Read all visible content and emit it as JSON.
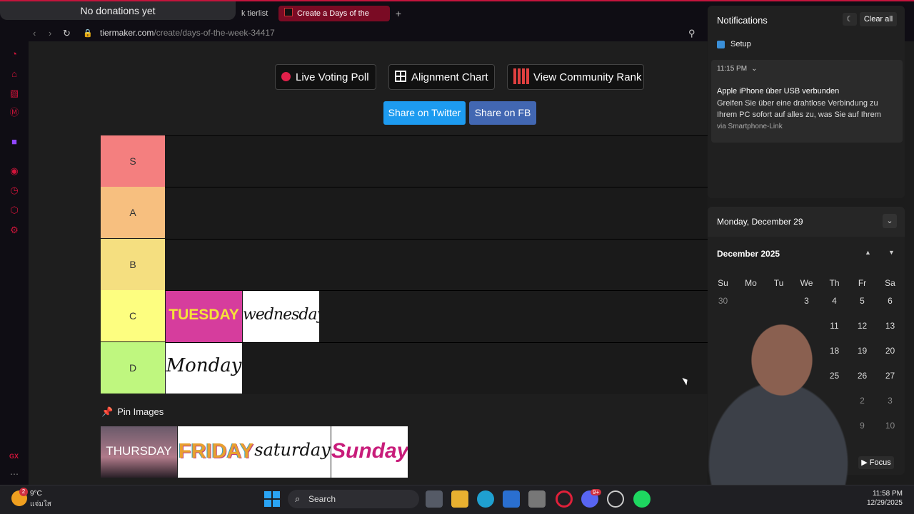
{
  "browser": {
    "donation_text": "No donations yet",
    "tabs": [
      {
        "label": "k tierlist -"
      },
      {
        "label": "Create a Days of the Week"
      }
    ],
    "new_tab": "+",
    "url_domain": "tiermaker.com",
    "url_path": "/create/days-of-the-week-34417"
  },
  "page": {
    "buttons": {
      "live_poll": "Live Voting Poll",
      "alignment": "Alignment Chart",
      "community": "View Community Rank",
      "share_twitter": "Share on Twitter",
      "share_fb": "Share on FB"
    },
    "tiers": [
      {
        "label": "S",
        "color": "#f47f7f"
      },
      {
        "label": "A",
        "color": "#f7bf7f"
      },
      {
        "label": "B",
        "color": "#f5df80"
      },
      {
        "label": "C",
        "color": "#fdfe80"
      },
      {
        "label": "D",
        "color": "#bff77f"
      }
    ],
    "tier_items": {
      "c1": "TUESDAY",
      "c2": "wednesday",
      "d1": "Monday"
    },
    "pin_label": "Pin Images",
    "pinned": [
      "THURSDAY",
      "FRIDAY",
      "saturday",
      "Sunday"
    ]
  },
  "notifications": {
    "title": "Notifications",
    "clear_all": "Clear all",
    "app": "Setup",
    "time": "11:15 PM",
    "heading": "Apple iPhone über USB verbunden",
    "body": "Greifen Sie über eine drahtlose Verbindung zu Ihrem PC sofort auf alles zu, was Sie auf Ihrem",
    "via": "via Smartphone-Link"
  },
  "calendar": {
    "date_header": "Monday, December 29",
    "month": "December 2025",
    "weekdays": [
      "Su",
      "Mo",
      "Tu",
      "We",
      "Th",
      "Fr",
      "Sa"
    ],
    "rows": [
      [
        "30",
        "",
        "",
        "3",
        "4",
        "5",
        "6"
      ],
      [
        "",
        "",
        "",
        "",
        "11",
        "12",
        "13"
      ],
      [
        "",
        "",
        "",
        "",
        "18",
        "19",
        "20"
      ],
      [
        "",
        "",
        "",
        "",
        "25",
        "26",
        "27"
      ],
      [
        "",
        "",
        "",
        "",
        "",
        "2",
        "3"
      ],
      [
        "",
        "",
        "",
        "",
        "",
        "9",
        "10"
      ]
    ],
    "focus": "Focus"
  },
  "taskbar": {
    "weather_temp": "9°C",
    "weather_desc": "แจ่มใส",
    "weather_badge": "2",
    "search": "Search",
    "time": "11:58 PM",
    "date": "12/29/2025",
    "discord_badge": "9+"
  },
  "sidebar_bottom": "GX"
}
